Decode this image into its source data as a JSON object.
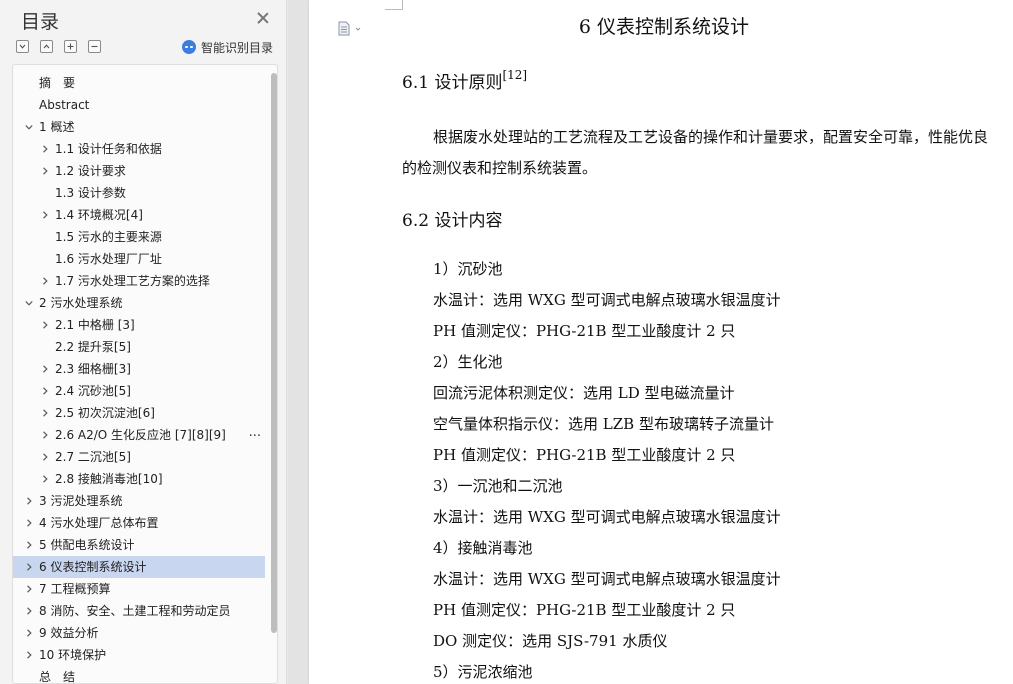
{
  "toc": {
    "title": "目录",
    "smart_label": "智能识别目录",
    "items": [
      {
        "label": "摘　要",
        "level": 0,
        "chevron": "none"
      },
      {
        "label": "Abstract",
        "level": 0,
        "chevron": "none"
      },
      {
        "label": "1  概述",
        "level": 0,
        "chevron": "down"
      },
      {
        "label": "1.1  设计任务和依据",
        "level": 1,
        "chevron": "right"
      },
      {
        "label": "1.2  设计要求",
        "level": 1,
        "chevron": "right"
      },
      {
        "label": "1.3  设计参数",
        "level": 1,
        "chevron": "none"
      },
      {
        "label": "1.4  环境概况[4]",
        "level": 1,
        "chevron": "right"
      },
      {
        "label": "1.5  污水的主要来源",
        "level": 1,
        "chevron": "none"
      },
      {
        "label": "1.6  污水处理厂厂址",
        "level": 1,
        "chevron": "none"
      },
      {
        "label": "1.7  污水处理工艺方案的选择",
        "level": 1,
        "chevron": "right"
      },
      {
        "label": "2  污水处理系统",
        "level": 0,
        "chevron": "down"
      },
      {
        "label": "2.1  中格栅  [3]",
        "level": 1,
        "chevron": "right"
      },
      {
        "label": "2.2  提升泵[5]",
        "level": 1,
        "chevron": "none"
      },
      {
        "label": "2.3  细格栅[3]",
        "level": 1,
        "chevron": "right"
      },
      {
        "label": "2.4  沉砂池[5]",
        "level": 1,
        "chevron": "right"
      },
      {
        "label": "2.5  初次沉淀池[6]",
        "level": 1,
        "chevron": "right"
      },
      {
        "label": "2.6 A2/O 生化反应池  [7][8][9]",
        "level": 1,
        "chevron": "right",
        "more": "..."
      },
      {
        "label": "2.7  二沉池[5]",
        "level": 1,
        "chevron": "right"
      },
      {
        "label": "2.8  接触消毒池[10]",
        "level": 1,
        "chevron": "right"
      },
      {
        "label": "3  污泥处理系统",
        "level": 0,
        "chevron": "right"
      },
      {
        "label": "4  污水处理厂总体布置",
        "level": 0,
        "chevron": "right"
      },
      {
        "label": "5  供配电系统设计",
        "level": 0,
        "chevron": "right"
      },
      {
        "label": "6  仪表控制系统设计",
        "level": 0,
        "chevron": "right",
        "selected": true
      },
      {
        "label": "7  工程概预算",
        "level": 0,
        "chevron": "right"
      },
      {
        "label": "8  消防、安全、土建工程和劳动定员",
        "level": 0,
        "chevron": "right"
      },
      {
        "label": "9  效益分析",
        "level": 0,
        "chevron": "right"
      },
      {
        "label": "10  环境保护",
        "level": 0,
        "chevron": "right"
      },
      {
        "label": "总　结",
        "level": 0,
        "chevron": "none"
      }
    ]
  },
  "document": {
    "chapter_title": "6  仪表控制系统设计",
    "section1": {
      "title": "6.1  设计原则",
      "ref": "[12]"
    },
    "paragraph1": {
      "line1": "根据废水处理站的工艺流程及工艺设备的操作和计量要求，配置安全可靠，性能优良",
      "line2": "的检测仪表和控制系统装置。"
    },
    "section2": {
      "title": "6.2  设计内容"
    },
    "lines": [
      "1）沉砂池",
      "水温计：选用 WXG 型可调式电解点玻璃水银温度计",
      "PH 值测定仪：PHG-21B 型工业酸度计 2 只",
      "2）生化池",
      "回流污泥体积测定仪：选用 LD 型电磁流量计",
      "空气量体积指示仪：选用 LZB 型布玻璃转子流量计",
      "PH 值测定仪：PHG-21B 型工业酸度计 2 只",
      "3）一沉池和二沉池",
      "水温计：选用 WXG 型可调式电解点玻璃水银温度计",
      "4）接触消毒池",
      "水温计：选用 WXG 型可调式电解点玻璃水银温度计",
      "PH 值测定仪：PHG-21B 型工业酸度计 2 只",
      "DO 测定仪：选用 SJS-791 水质仪",
      "5）污泥浓缩池"
    ]
  },
  "colors": {
    "selected_row": "#c9d6ef",
    "smart_icon": "#3d7de0"
  }
}
